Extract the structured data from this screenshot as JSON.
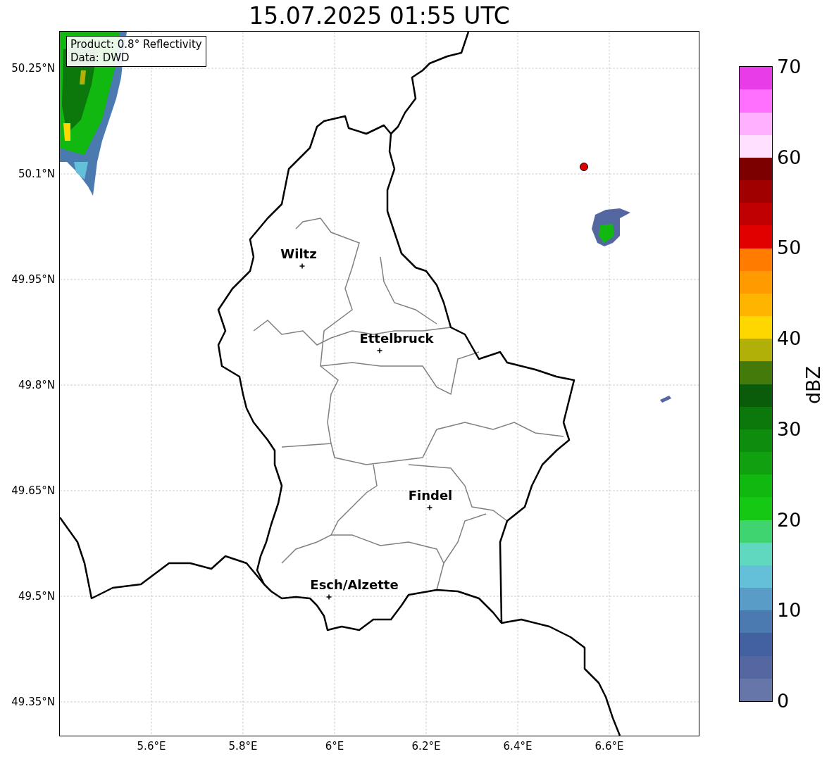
{
  "title": "15.07.2025 01:55 UTC",
  "info_box": [
    "Product: 0.8° Reflectivity",
    "Data: DWD"
  ],
  "lat_ticks": [
    {
      "label": "50.25°N"
    },
    {
      "label": "50.1°N"
    },
    {
      "label": "49.95°N"
    },
    {
      "label": "49.8°N"
    },
    {
      "label": "49.65°N"
    },
    {
      "label": "49.5°N"
    },
    {
      "label": "49.35°N"
    }
  ],
  "lon_ticks": [
    {
      "label": "5.6°E"
    },
    {
      "label": "5.8°E"
    },
    {
      "label": "6°E"
    },
    {
      "label": "6.2°E"
    },
    {
      "label": "6.4°E"
    },
    {
      "label": "6.6°E"
    }
  ],
  "cities": [
    {
      "name": "Wiltz"
    },
    {
      "name": "Ettelbruck"
    },
    {
      "name": "Findel"
    },
    {
      "name": "Esch/Alzette"
    }
  ],
  "colorbar": {
    "label": "dBZ",
    "ticks": [
      "70",
      "60",
      "50",
      "40",
      "30",
      "20",
      "10",
      "0"
    ],
    "bins": [
      {
        "color": "#6676a8"
      },
      {
        "color": "#5467a0"
      },
      {
        "color": "#4360a0"
      },
      {
        "color": "#4a7ab0"
      },
      {
        "color": "#5a9cc8"
      },
      {
        "color": "#64c0d8"
      },
      {
        "color": "#60d8c0"
      },
      {
        "color": "#40d470"
      },
      {
        "color": "#14c814"
      },
      {
        "color": "#10b810"
      },
      {
        "color": "#10a010"
      },
      {
        "color": "#0e8c0e"
      },
      {
        "color": "#0c780c"
      },
      {
        "color": "#0a5c0a"
      },
      {
        "color": "#447a0a"
      },
      {
        "color": "#b0b008"
      },
      {
        "color": "#ffd700"
      },
      {
        "color": "#ffb400"
      },
      {
        "color": "#ff9a00"
      },
      {
        "color": "#ff7c00"
      },
      {
        "color": "#e00000"
      },
      {
        "color": "#c00000"
      },
      {
        "color": "#a00000"
      },
      {
        "color": "#7c0000"
      },
      {
        "color": "#ffe0ff"
      },
      {
        "color": "#ffb0ff"
      },
      {
        "color": "#ff70ff"
      },
      {
        "color": "#e83ce8"
      }
    ]
  }
}
